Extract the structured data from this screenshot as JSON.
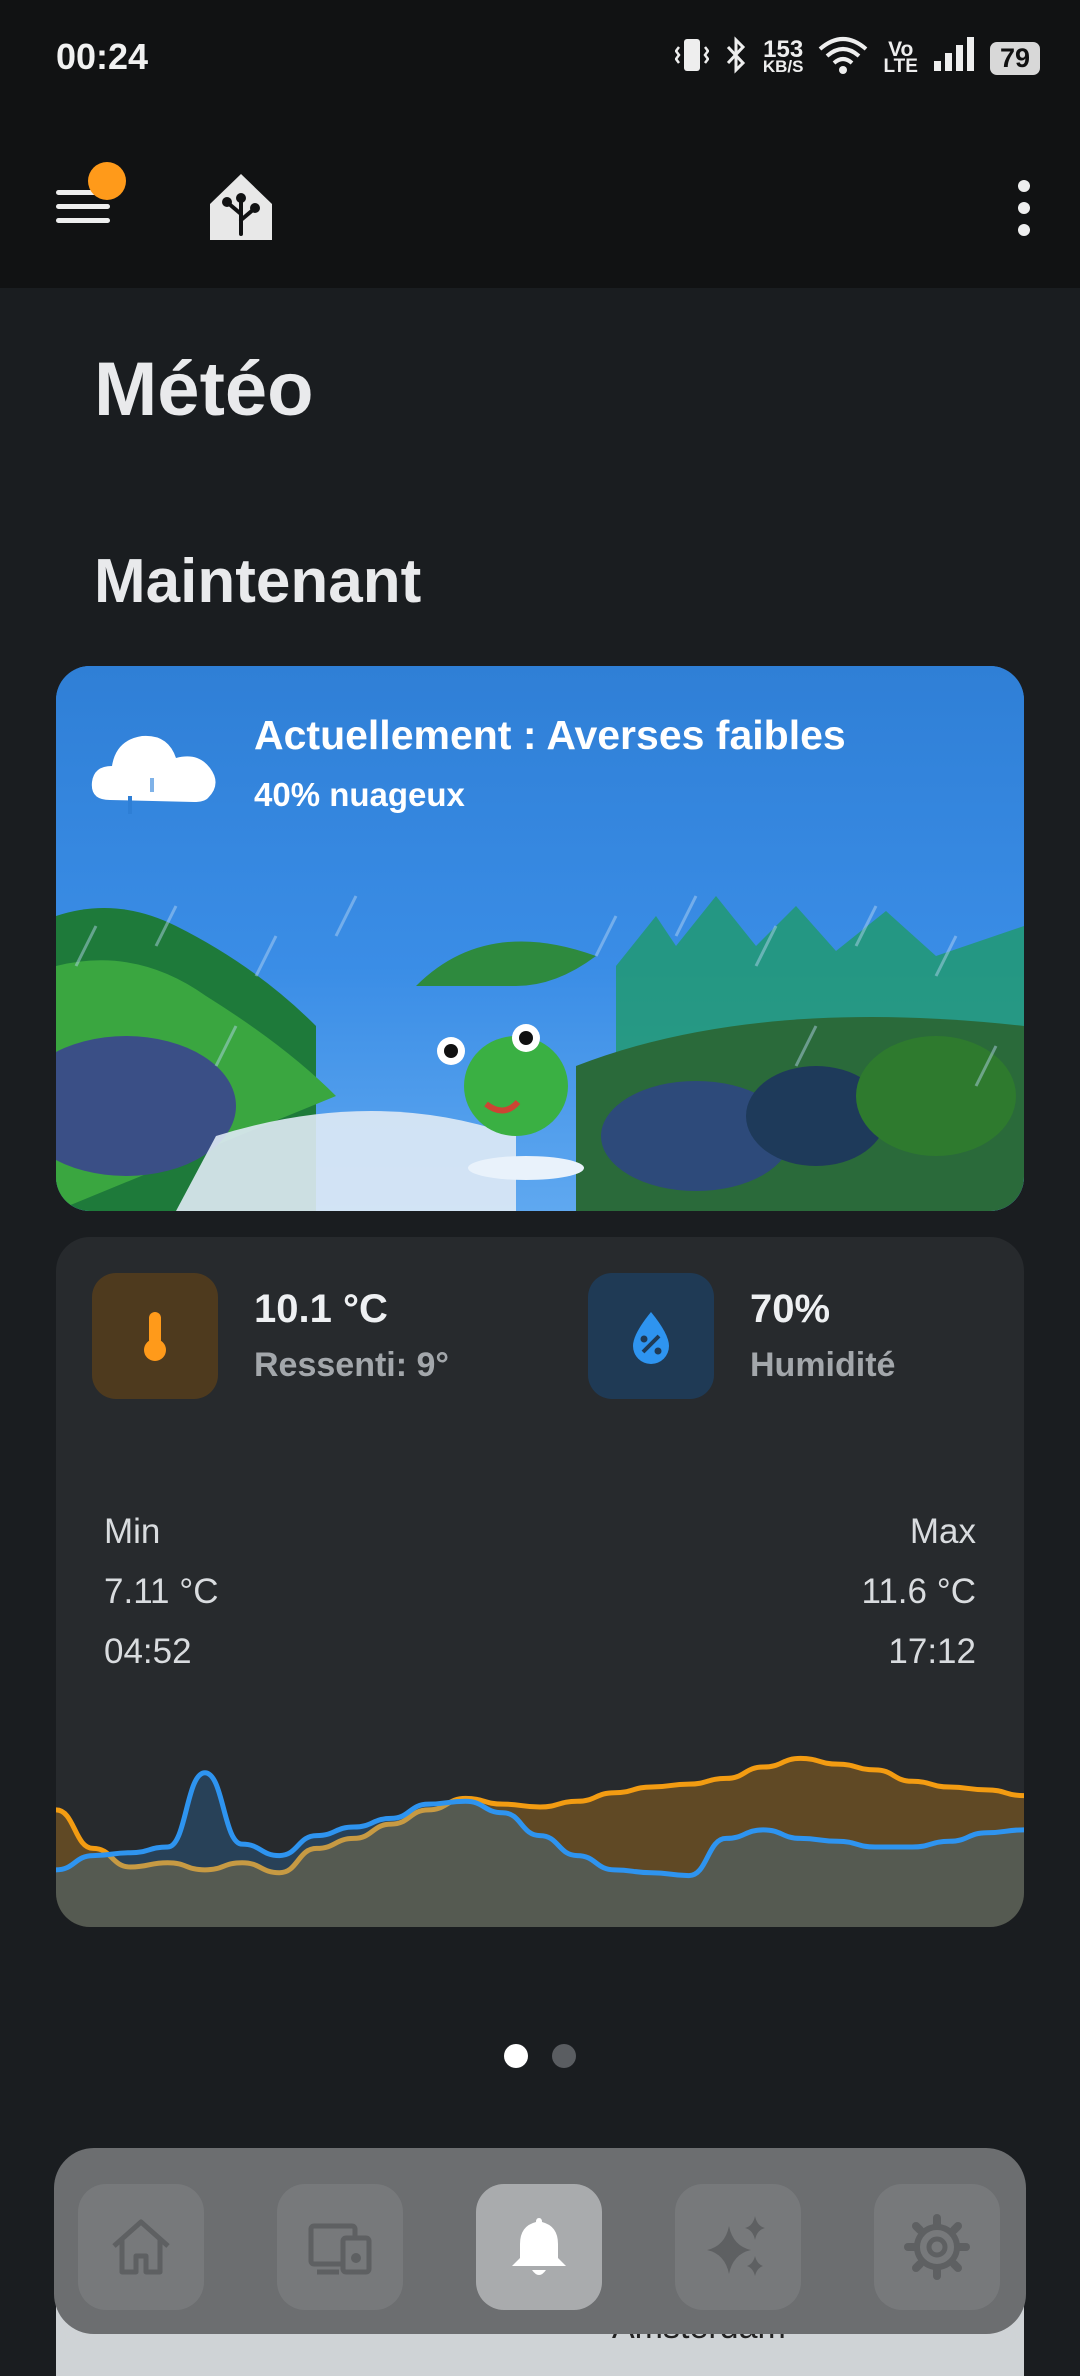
{
  "status_bar": {
    "time": "00:24",
    "net_speed_value": "153",
    "net_speed_unit": "KB/S",
    "volte_top": "Vo",
    "volte_bottom": "LTE",
    "battery": "79"
  },
  "app_bar": {
    "menu_badge_color": "#ff9a1a"
  },
  "page": {
    "title": "Météo",
    "section_title": "Maintenant"
  },
  "weather_card": {
    "condition_line": "Actuellement : Averses faibles",
    "cloud_line": "40% nuageux",
    "background_color": "#2f7fd6"
  },
  "sensors": {
    "temperature": {
      "value": "10.1 °C",
      "feels_like": "Ressenti: 9°",
      "icon": "thermometer-icon",
      "color": "#ff9a1a"
    },
    "humidity": {
      "value": "70%",
      "label": "Humidité",
      "icon": "water-percent-icon",
      "color": "#2e94f0"
    },
    "min": {
      "label": "Min",
      "value": "7.11 °C",
      "time": "04:52"
    },
    "max": {
      "label": "Max",
      "value": "11.6 °C",
      "time": "17:12"
    }
  },
  "chart_data": {
    "type": "area",
    "series": [
      {
        "color": "#f39c12",
        "values": [
          0.82,
          0.55,
          0.42,
          0.45,
          0.4,
          0.45,
          0.38,
          0.55,
          0.62,
          0.72,
          0.82,
          0.9,
          0.86,
          0.84,
          0.88,
          0.94,
          0.98,
          1.0,
          1.04,
          1.12,
          1.18,
          1.14,
          1.1,
          1.02,
          0.98,
          0.96,
          0.92
        ]
      },
      {
        "color": "#2e94f0",
        "values": [
          0.4,
          0.5,
          0.52,
          0.56,
          1.08,
          0.58,
          0.5,
          0.64,
          0.7,
          0.76,
          0.86,
          0.88,
          0.8,
          0.64,
          0.5,
          0.4,
          0.38,
          0.36,
          0.62,
          0.68,
          0.62,
          0.6,
          0.56,
          0.56,
          0.6,
          0.66,
          0.68
        ]
      }
    ]
  },
  "pager": {
    "count": 2,
    "active": 0
  },
  "map_peek": {
    "label": "Amsterdam"
  },
  "bottom_nav": {
    "items": [
      "home-icon",
      "devices-icon",
      "bell-icon",
      "sparkle-icon",
      "settings-gear-icon"
    ],
    "active_item": "bell-icon"
  }
}
